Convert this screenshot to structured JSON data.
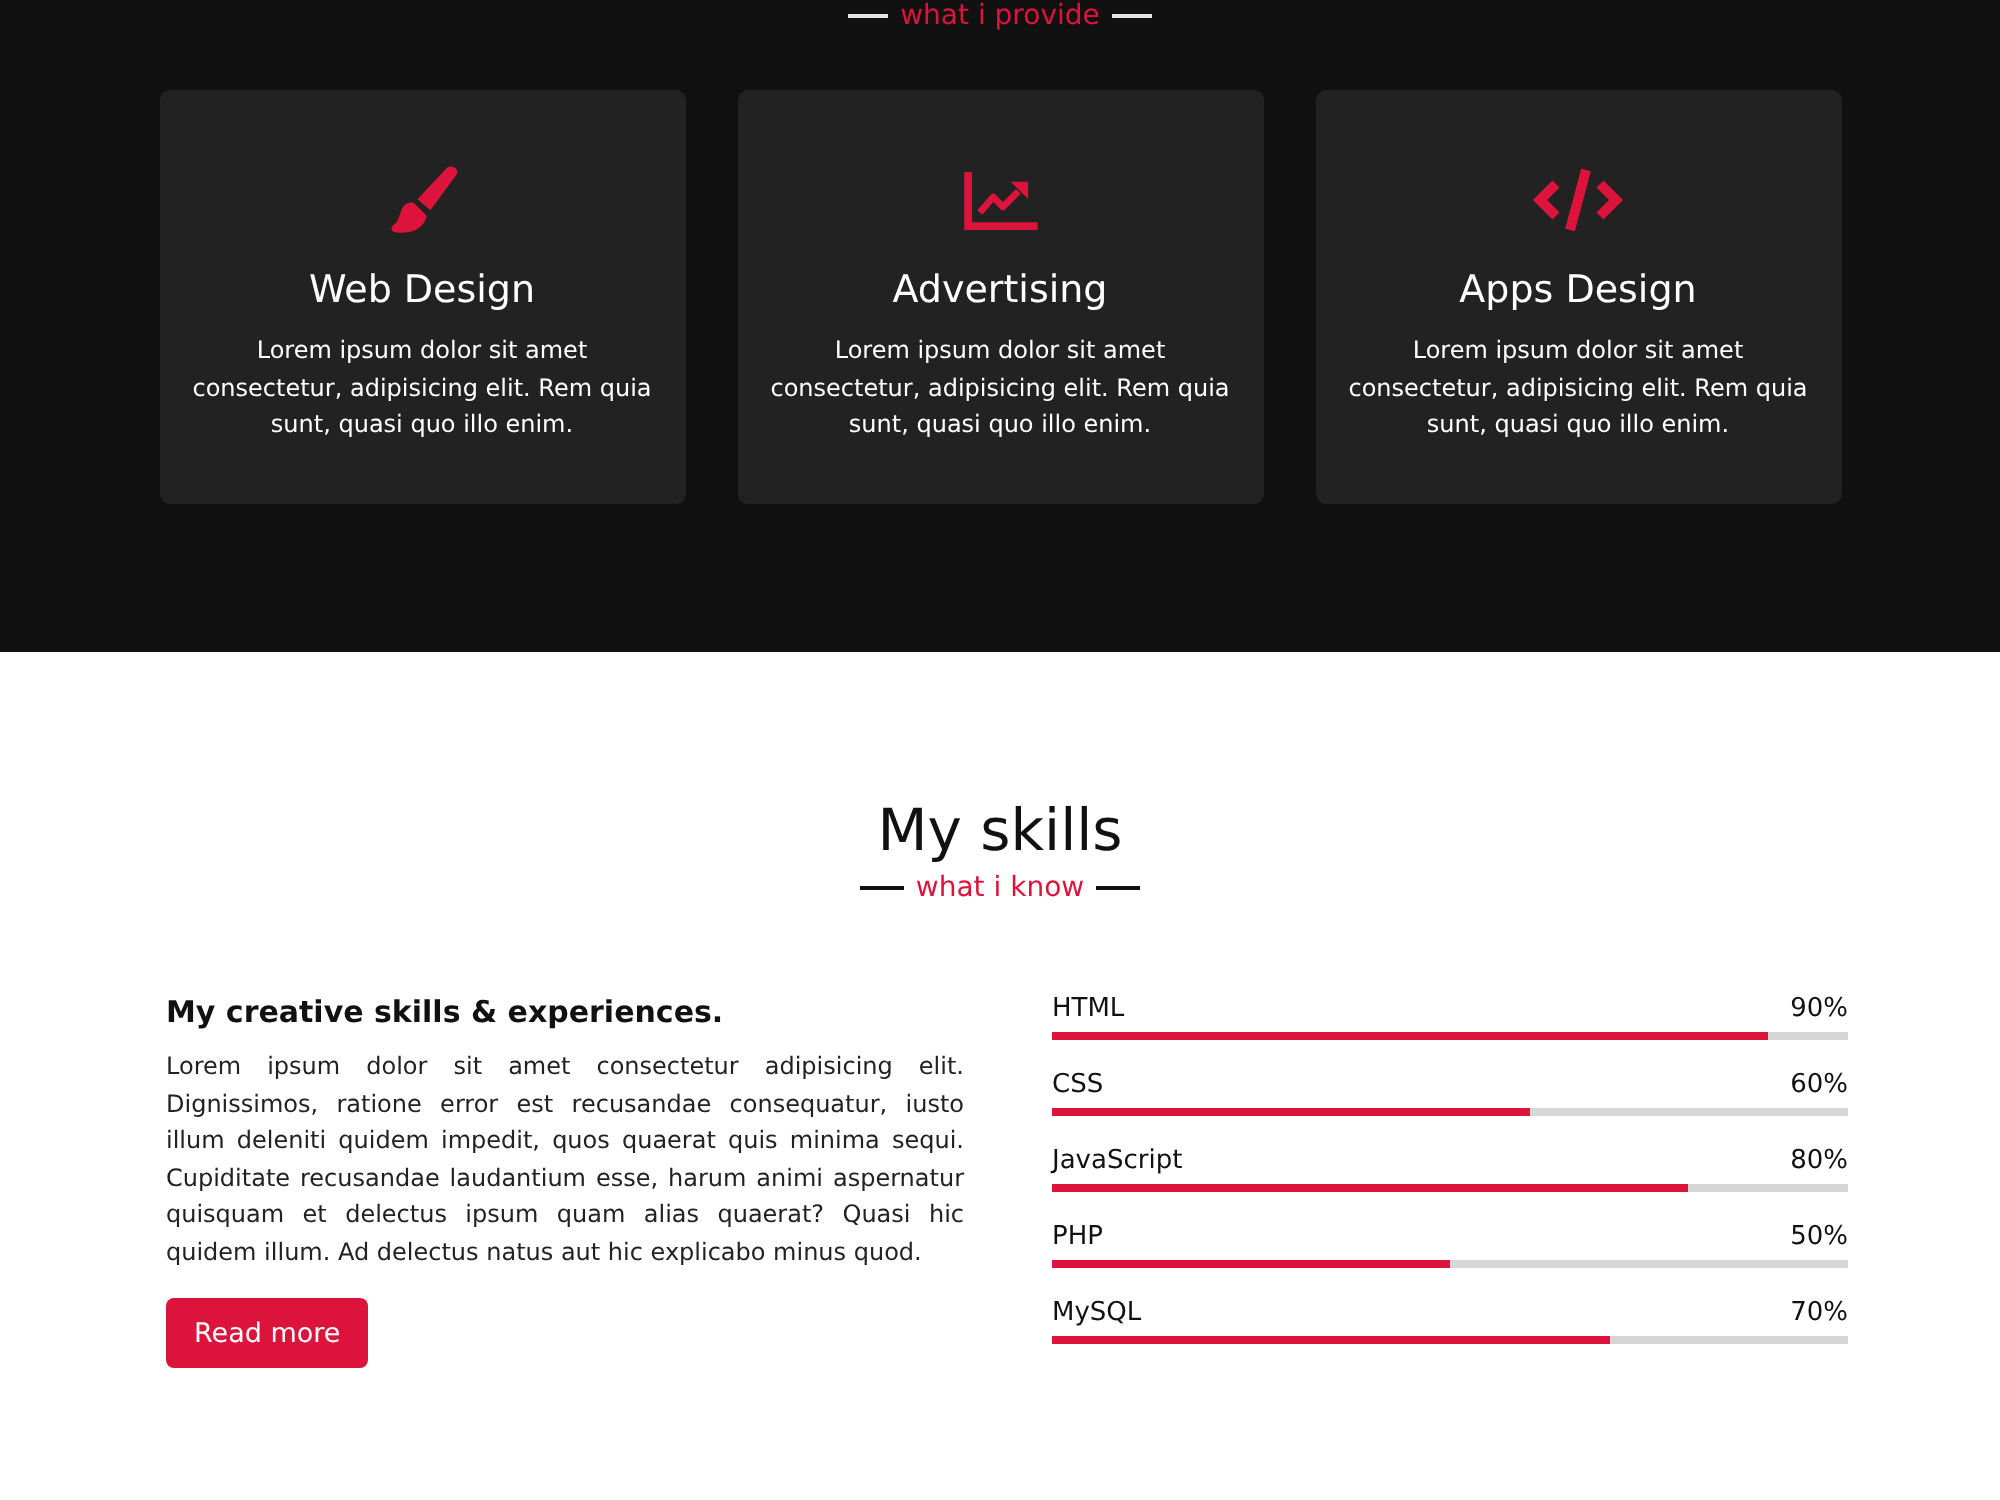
{
  "services": {
    "subtitle": "what i provide",
    "cards": [
      {
        "title": "Web Design",
        "text": "Lorem ipsum dolor sit amet consectetur, adipisicing elit. Rem quia sunt, quasi quo illo enim."
      },
      {
        "title": "Advertising",
        "text": "Lorem ipsum dolor sit amet consectetur, adipisicing elit. Rem quia sunt, quasi quo illo enim."
      },
      {
        "title": "Apps Design",
        "text": "Lorem ipsum dolor sit amet consectetur, adipisicing elit. Rem quia sunt, quasi quo illo enim."
      }
    ]
  },
  "skills": {
    "title": "My skills",
    "subtitle": "what i know",
    "heading": "My creative skills & experiences.",
    "text": "Lorem ipsum dolor sit amet consectetur adipisicing elit. Dignissimos, ratione error est recusandae consequatur, iusto illum deleniti quidem impedit, quos quaerat quis minima sequi. Cupiditate recusandae laudantium esse, harum animi aspernatur quisquam et delectus ipsum quam alias quaerat? Quasi hic quidem illum. Ad delectus natus aut hic explicabo minus quod.",
    "button": "Read more",
    "bars": [
      {
        "name": "HTML",
        "reading": "90%",
        "level": 0.9
      },
      {
        "name": "CSS",
        "reading": "60%",
        "level": 0.6
      },
      {
        "name": "JavaScript",
        "reading": "80%",
        "level": 0.8
      },
      {
        "name": "PHP",
        "reading": "50%",
        "level": 0.5
      },
      {
        "name": "MySQL",
        "reading": "70%",
        "level": 0.7
      }
    ]
  }
}
